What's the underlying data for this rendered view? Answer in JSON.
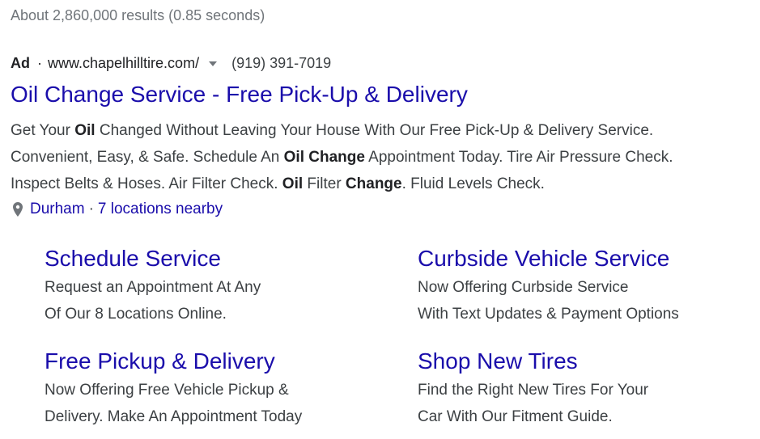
{
  "stats": "About 2,860,000 results (0.85 seconds)",
  "ad": {
    "label": "Ad",
    "separator": "·",
    "url": "www.chapelhilltire.com/",
    "phone": "(919) 391-7019",
    "headline": "Oil Change Service - Free Pick-Up & Delivery",
    "description": {
      "line1": {
        "a": "Get Your ",
        "b1": "Oil",
        "c": " Changed Without Leaving Your House With Our Free Pick-Up & Delivery Service."
      },
      "line2": {
        "a": "Convenient, Easy, & Safe. Schedule An ",
        "b1": "Oil Change",
        "c": " Appointment Today. Tire Air Pressure Check."
      },
      "line3": {
        "a": "Inspect Belts & Hoses. Air Filter Check. ",
        "b1": "Oil",
        "c": " Filter ",
        "b2": "Change",
        "d": ". Fluid Levels Check."
      }
    },
    "location": {
      "city": "Durham",
      "separator": "·",
      "nearby": "7 locations nearby"
    }
  },
  "sitelinks": [
    {
      "title": "Schedule Service",
      "line1": "Request an Appointment At Any",
      "line2": "Of Our 8 Locations Online."
    },
    {
      "title": "Curbside Vehicle Service",
      "line1": "Now Offering Curbside Service",
      "line2": "With Text Updates & Payment Options"
    },
    {
      "title": "Free Pickup & Delivery",
      "line1": "Now Offering Free Vehicle Pickup &",
      "line2": "Delivery. Make An Appointment Today"
    },
    {
      "title": "Shop New Tires",
      "line1": "Find the Right New Tires For Your",
      "line2": "Car With Our Fitment Guide."
    }
  ],
  "colors": {
    "link": "#1a0dab",
    "text": "#3c4043",
    "muted": "#70757a"
  },
  "icons": {
    "location": "map-pin-icon",
    "url_menu": "caret-down-icon"
  }
}
